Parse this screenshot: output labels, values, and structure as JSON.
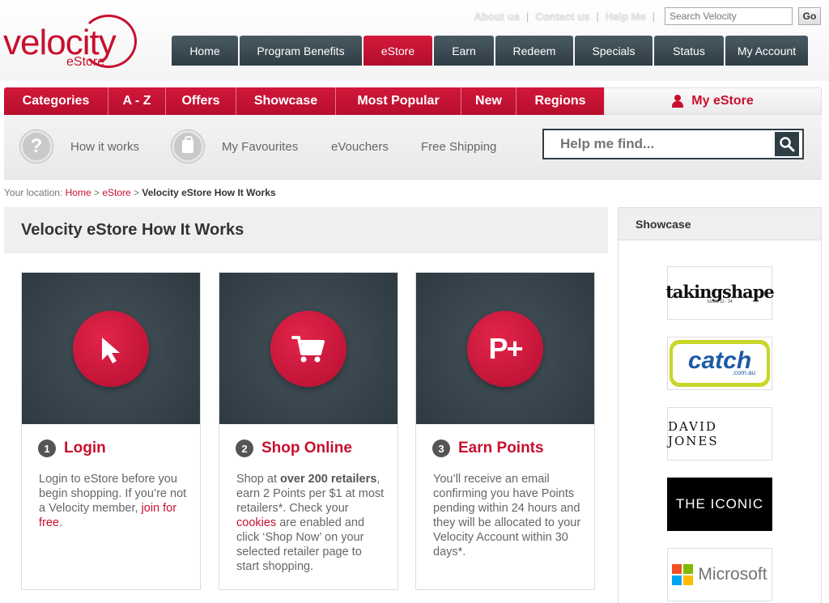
{
  "brand": {
    "name": "velocity",
    "sub": "eStore"
  },
  "utility": {
    "links": [
      "About us",
      "Contact us",
      "Help Me"
    ],
    "search_placeholder": "Search Velocity",
    "go_label": "Go"
  },
  "mainnav": [
    "Home",
    "Program Benefits",
    "eStore",
    "Earn",
    "Redeem",
    "Specials",
    "Status",
    "My Account"
  ],
  "mainnav_active": "eStore",
  "subnav": [
    "Categories",
    "A - Z",
    "Offers",
    "Showcase",
    "Most Popular",
    "New",
    "Regions"
  ],
  "my_estore": "My eStore",
  "toolbar": {
    "how": "How it works",
    "fav": "My Favourites",
    "vouchers": "eVouchers",
    "shipping": "Free Shipping",
    "find_placeholder": "Help me find...",
    "help_icon": "?"
  },
  "breadcrumb": {
    "prefix": "Your location:",
    "home": "Home",
    "estore": "eStore",
    "current": "Velocity eStore How It Works",
    "sep": ">"
  },
  "page_title": "Velocity eStore How It Works",
  "steps": [
    {
      "num": "1",
      "title": "Login",
      "t1": "Login to eStore before you begin shopping. If you’re not a Velocity member, ",
      "link": "join for free",
      "t2": "."
    },
    {
      "num": "2",
      "title": "Shop Online",
      "t1": "Shop at ",
      "bold": "over 200 retailers",
      "t2": ", earn 2 Points per $1 at most retailers*. Check your ",
      "link": "cookies",
      "t3": " are enabled and click ‘Shop Now’ on your selected retailer page to start shopping."
    },
    {
      "num": "3",
      "title": "Earn Points",
      "t1": "You’ll receive an email confirming you have Points pending within 24 hours and they will be allocated to your Velocity Account within 30 days*.",
      "icon_text": "P+"
    }
  ],
  "showcase": {
    "title": "Showcase",
    "logos": [
      "takingshape",
      "SIZES 12 - 24",
      "catch",
      ".com.au",
      "DAVID JONES",
      "THE ICONIC",
      "Microsoft"
    ]
  },
  "colors": {
    "brand_red": "#c8102e",
    "nav_dark": "#2f3d45"
  }
}
